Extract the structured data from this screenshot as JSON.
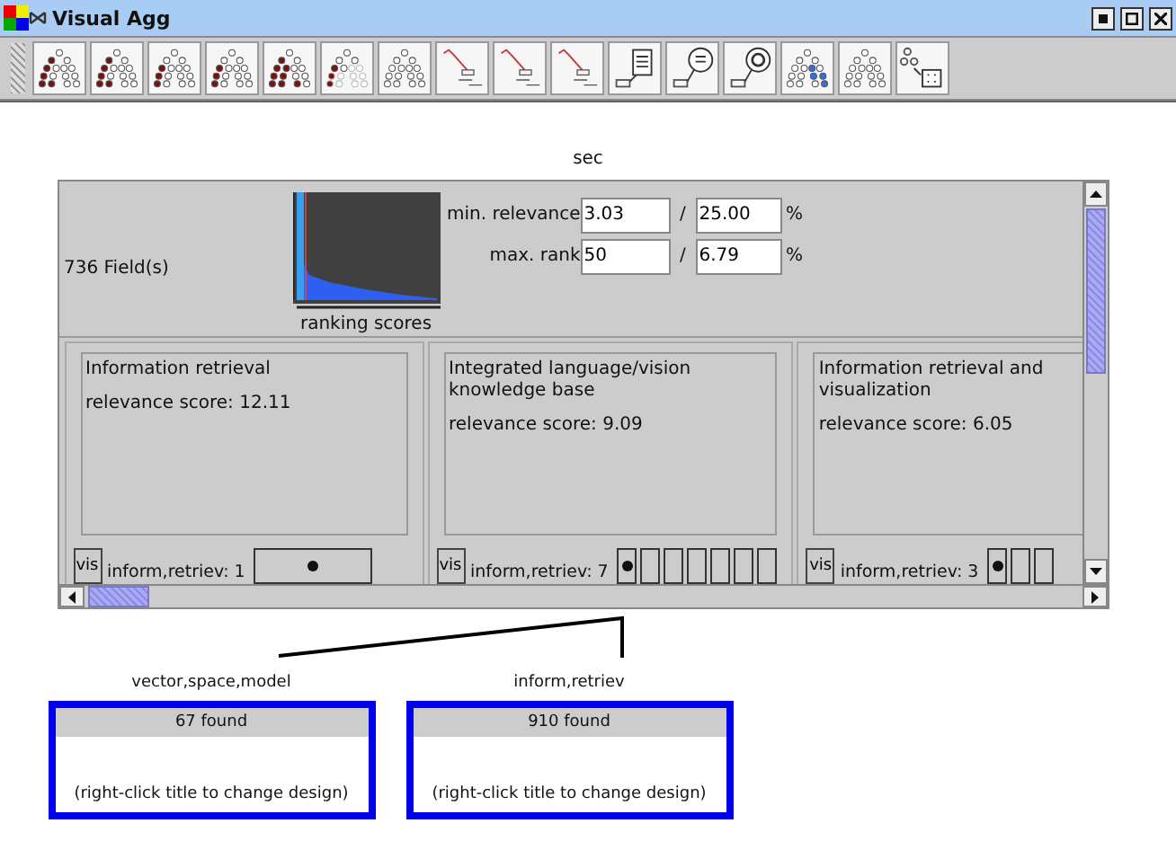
{
  "window": {
    "title": "Visual Agg"
  },
  "toolbar": [
    {
      "kind": "tree"
    },
    {
      "kind": "tree"
    },
    {
      "kind": "tree"
    },
    {
      "kind": "tree"
    },
    {
      "kind": "tree"
    },
    {
      "kind": "tree"
    },
    {
      "kind": "tree"
    },
    {
      "kind": "steps"
    },
    {
      "kind": "steps"
    },
    {
      "kind": "steps"
    },
    {
      "kind": "document"
    },
    {
      "kind": "bubble"
    },
    {
      "kind": "target"
    },
    {
      "kind": "tree"
    },
    {
      "kind": "tree"
    },
    {
      "kind": "grid"
    }
  ],
  "canvas_label": "sec",
  "panel": {
    "field_count": "736 Field(s)",
    "chart_label": "ranking scores",
    "min_relevance": {
      "label": "min. relevance",
      "value": "3.03",
      "separator": "/",
      "percent_value": "25.00",
      "unit": "%"
    },
    "max_rank": {
      "label": "max. rank",
      "value": "50",
      "separator": "/",
      "percent_value": "6.79",
      "unit": "%"
    },
    "cards": [
      {
        "title": "Information retrieval",
        "score": "relevance score: 12.11",
        "vis": "vis",
        "term": "inform,retriev: 1",
        "bins": [
          {
            "filled": true,
            "wide": true
          }
        ]
      },
      {
        "title": "Integrated language/vision knowledge base",
        "score": "relevance score: 9.09",
        "vis": "vis",
        "term": "inform,retriev: 7",
        "bins": [
          {
            "filled": true,
            "wide": false
          },
          {
            "filled": false,
            "wide": false
          },
          {
            "filled": false,
            "wide": false
          },
          {
            "filled": false,
            "wide": false
          },
          {
            "filled": false,
            "wide": false
          },
          {
            "filled": false,
            "wide": false
          },
          {
            "filled": false,
            "wide": false
          }
        ]
      },
      {
        "title": "Information retrieval and visualization",
        "score": "relevance score: 6.05",
        "vis": "vis",
        "term": "inform,retriev: 3",
        "bins": [
          {
            "filled": true,
            "wide": false
          },
          {
            "filled": false,
            "wide": false
          },
          {
            "filled": false,
            "wide": false
          }
        ]
      }
    ]
  },
  "result_nodes": [
    {
      "label": "vector,space,model",
      "count": "67 found",
      "hint": "(right-click title to change design)"
    },
    {
      "label": "inform,retriev",
      "count": "910 found",
      "hint": "(right-click title to change design)"
    }
  ]
}
